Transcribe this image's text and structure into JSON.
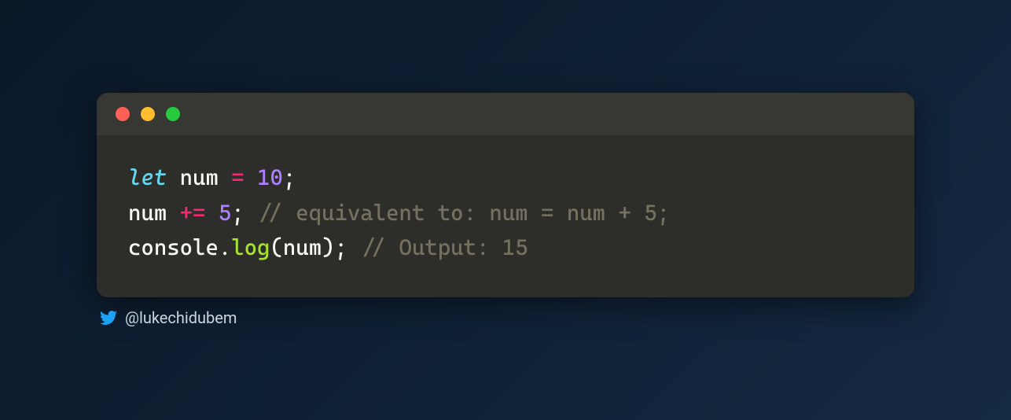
{
  "code": {
    "line1": {
      "keyword": "let",
      "ident": " num ",
      "op": "=",
      "num": " 10",
      "semi": ";"
    },
    "line2": {
      "ident": "num ",
      "op": "+=",
      "num": " 5",
      "semi": "; ",
      "comment": "// equivalent to: num = num + 5;"
    },
    "line3": {
      "obj": "console",
      "dot": ".",
      "method": "log",
      "open": "(",
      "arg": "num",
      "close": "); ",
      "comment": "// Output: 15"
    }
  },
  "attribution": {
    "handle": "@lukechidubem"
  }
}
